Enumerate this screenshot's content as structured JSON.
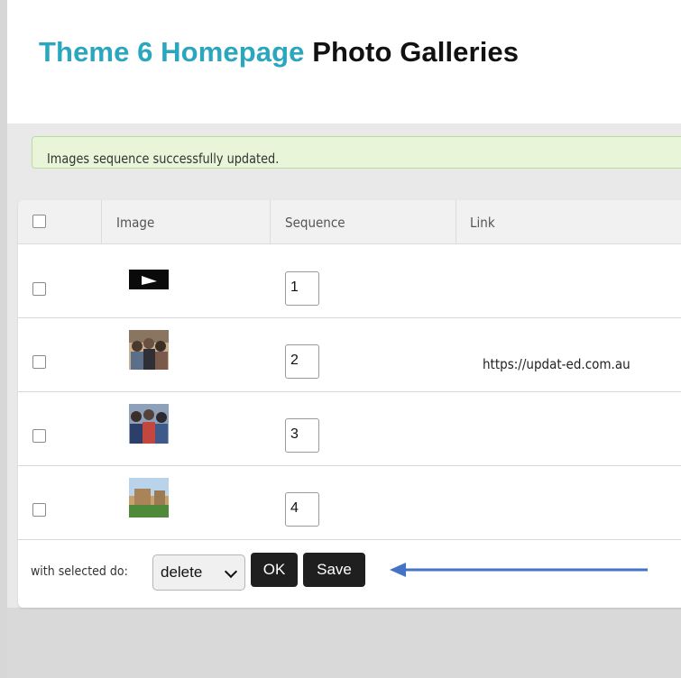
{
  "page": {
    "title_part1": "Theme 6 Homepage",
    "title_part2": "Photo Galleries"
  },
  "alert": {
    "message": "Images sequence successfully updated."
  },
  "table": {
    "headers": [
      "Image",
      "Sequence",
      "Link"
    ],
    "rows": [
      {
        "sequence": "1",
        "link": "",
        "thumbnail": "video-play-icon"
      },
      {
        "sequence": "2",
        "link": "https://updat-ed.com.au",
        "thumbnail": "group-photo-thumbnail"
      },
      {
        "sequence": "3",
        "link": "",
        "thumbnail": "crowd-photo-thumbnail"
      },
      {
        "sequence": "4",
        "link": "",
        "thumbnail": "building-photo-thumbnail"
      }
    ]
  },
  "footer": {
    "label": "with selected do:",
    "action_selected": "delete",
    "ok_label": "OK",
    "save_label": "Save"
  },
  "colors": {
    "title_accent": "#2aa6bf",
    "alert_bg": "#e8f5d8",
    "button_bg": "#1f1f1f",
    "arrow": "#4472c4"
  }
}
